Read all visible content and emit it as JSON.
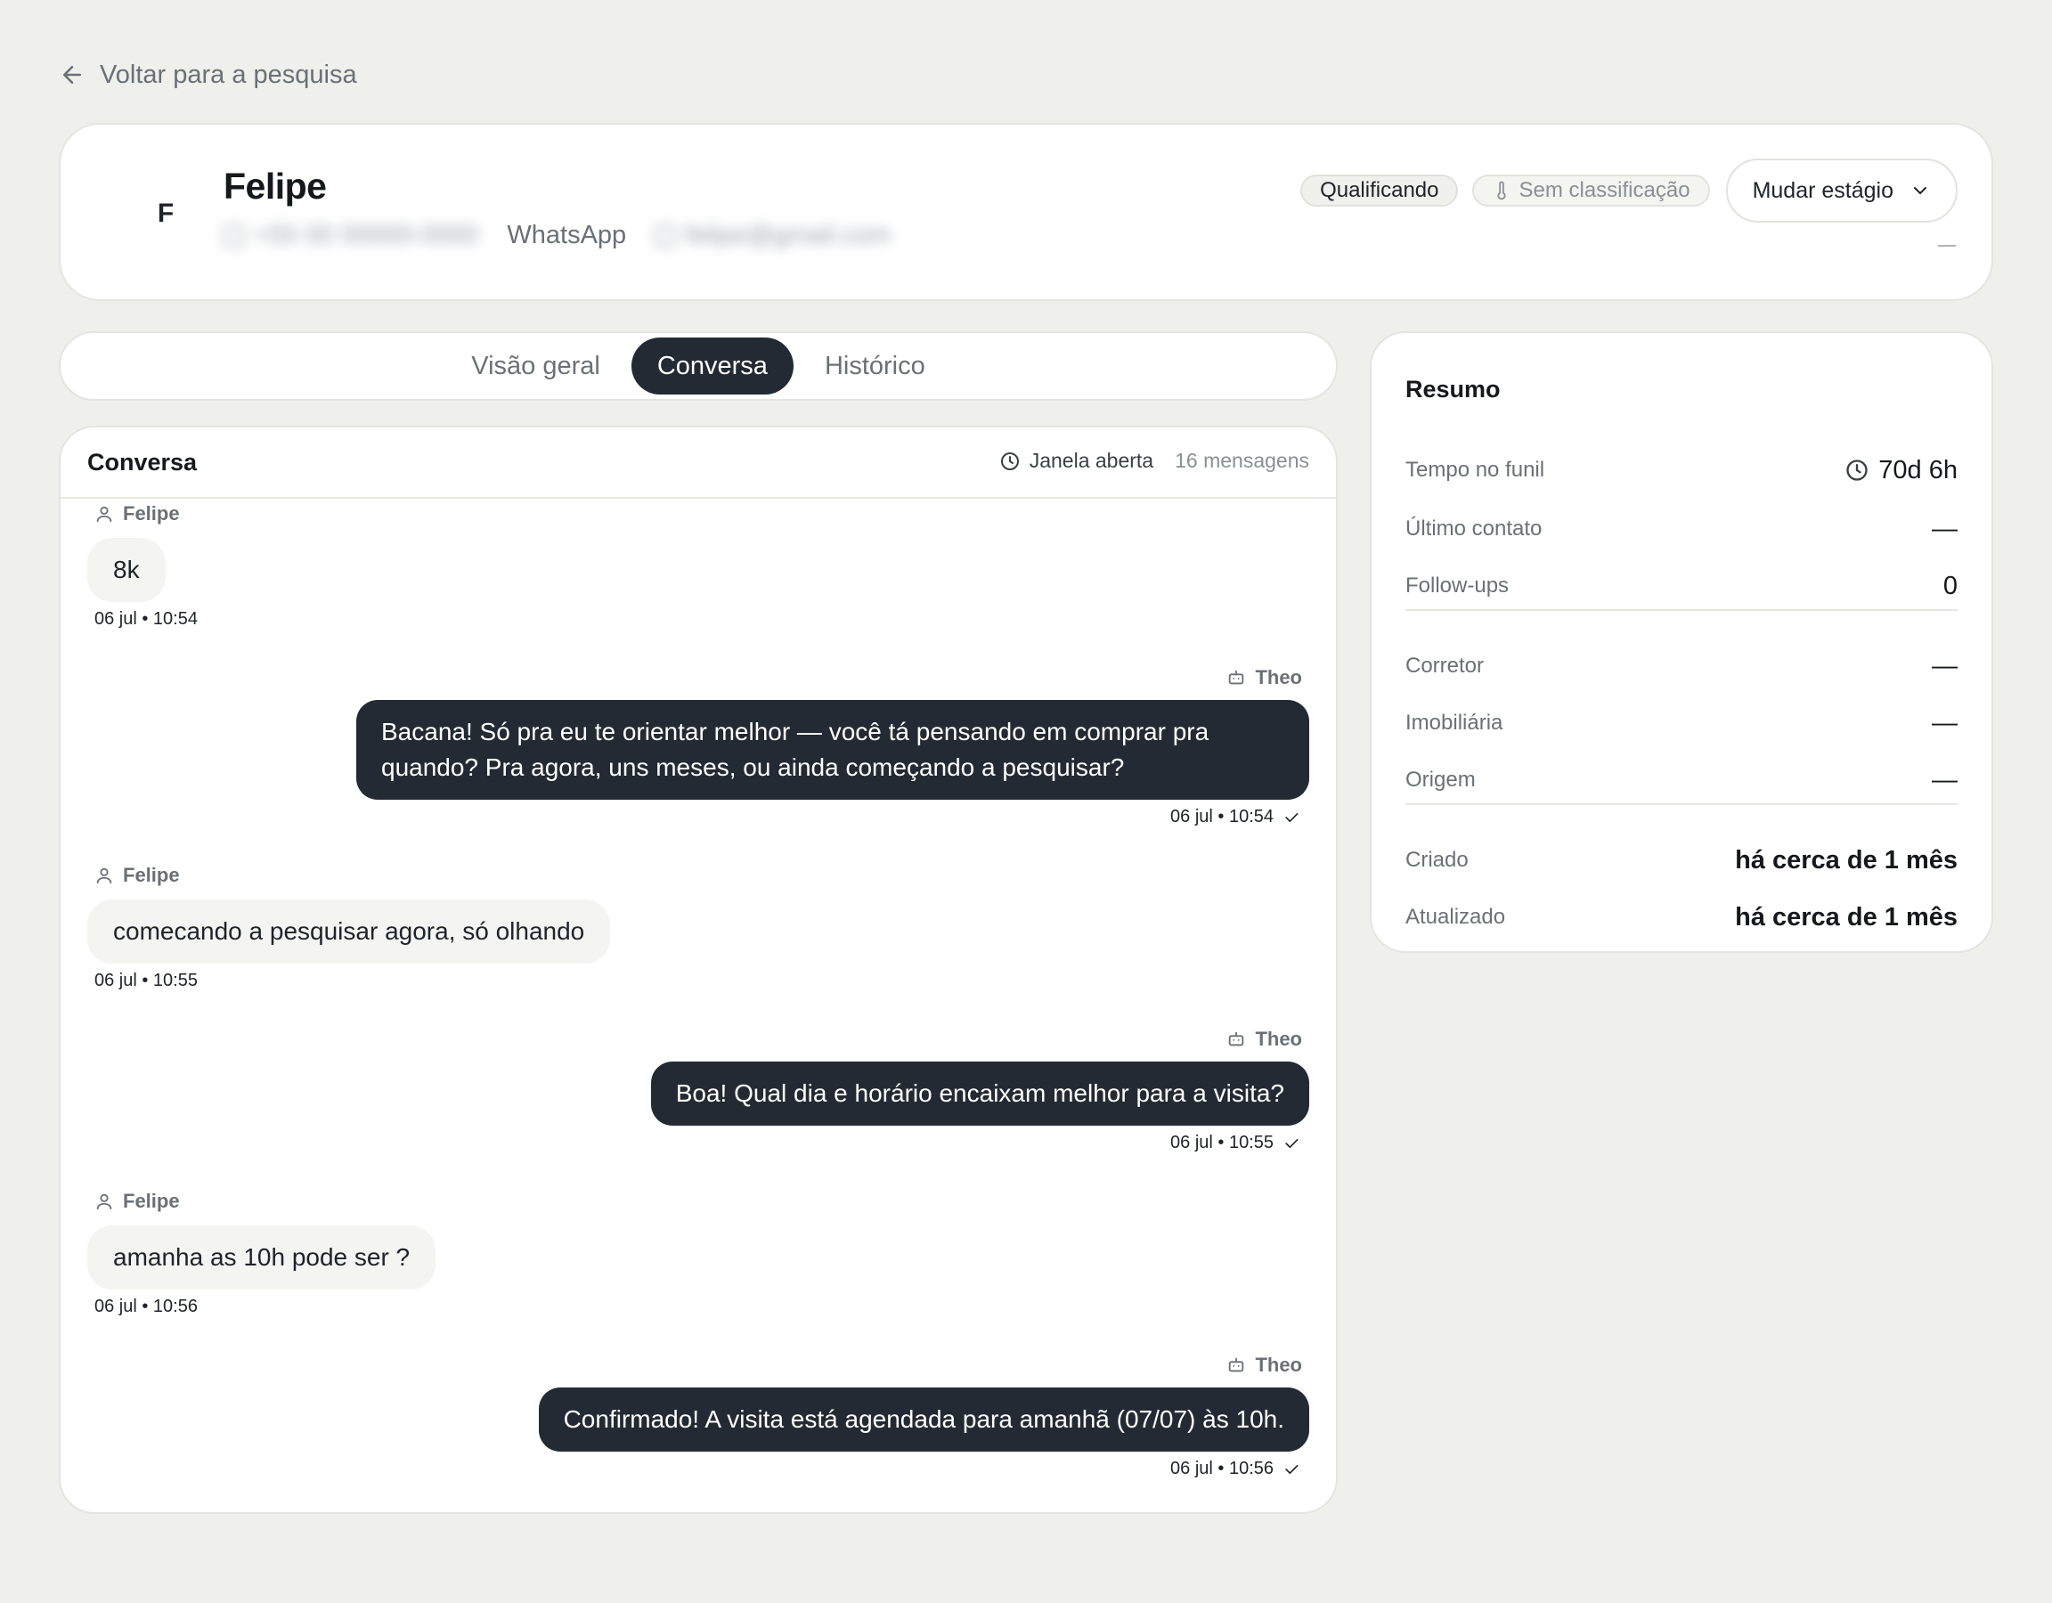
{
  "back_link": {
    "label": "Voltar para a pesquisa"
  },
  "lead": {
    "avatar_initial": "F",
    "name": "Felipe",
    "phone": "+55 00 00000-0000",
    "channel": "WhatsApp",
    "email": "felipe@gmail.com",
    "stage_badge": "Qualificando",
    "temperature_badge": "Sem classificação",
    "stage_button": "Mudar estágio",
    "extra": "—"
  },
  "tabs": [
    {
      "label": "Visão geral",
      "active": false
    },
    {
      "label": "Conversa",
      "active": true
    },
    {
      "label": "Histórico",
      "active": false
    }
  ],
  "conversation": {
    "title": "Conversa",
    "window_status": "Janela aberta",
    "message_count": "16 mensagens",
    "messages": [
      {
        "direction": "in",
        "sender": "Felipe",
        "text": "8k",
        "time": "06 jul • 10:54"
      },
      {
        "direction": "out",
        "sender": "Theo",
        "text": "Bacana! Só pra eu te orientar melhor — você tá pensando em comprar pra quando? Pra agora, uns meses, ou ainda começando a pesquisar?",
        "time": "06 jul • 10:54"
      },
      {
        "direction": "in",
        "sender": "Felipe",
        "text": "comecando a pesquisar agora, só olhando",
        "time": "06 jul • 10:55"
      },
      {
        "direction": "out",
        "sender": "Theo",
        "text": "Boa! Qual dia e horário encaixam melhor para a visita?",
        "time": "06 jul • 10:55"
      },
      {
        "direction": "in",
        "sender": "Felipe",
        "text": "amanha as 10h pode ser ?",
        "time": "06 jul • 10:56"
      },
      {
        "direction": "out",
        "sender": "Theo",
        "text": "Confirmado! A visita está agendada para amanhã (07/07) às 10h.",
        "time": "06 jul • 10:56"
      }
    ]
  },
  "summary": {
    "title": "Resumo",
    "rows": [
      {
        "label": "Tempo no funil",
        "value": "70d 6h"
      },
      {
        "label": "Último contato",
        "value": "—"
      },
      {
        "label": "Follow-ups",
        "value": "0"
      },
      {
        "label": "Corretor",
        "value": "—"
      },
      {
        "label": "Imobiliária",
        "value": "—"
      },
      {
        "label": "Origem",
        "value": "—"
      },
      {
        "label": "Criado",
        "value": "há cerca de 1 mês"
      },
      {
        "label": "Atualizado",
        "value": "há cerca de 1 mês"
      }
    ]
  },
  "colors": {
    "background": "#efefeb",
    "card": "#ffffff",
    "dark_bubble": "#232a33",
    "light_bubble": "#f4f4f2",
    "muted_text": "#6b7077"
  }
}
